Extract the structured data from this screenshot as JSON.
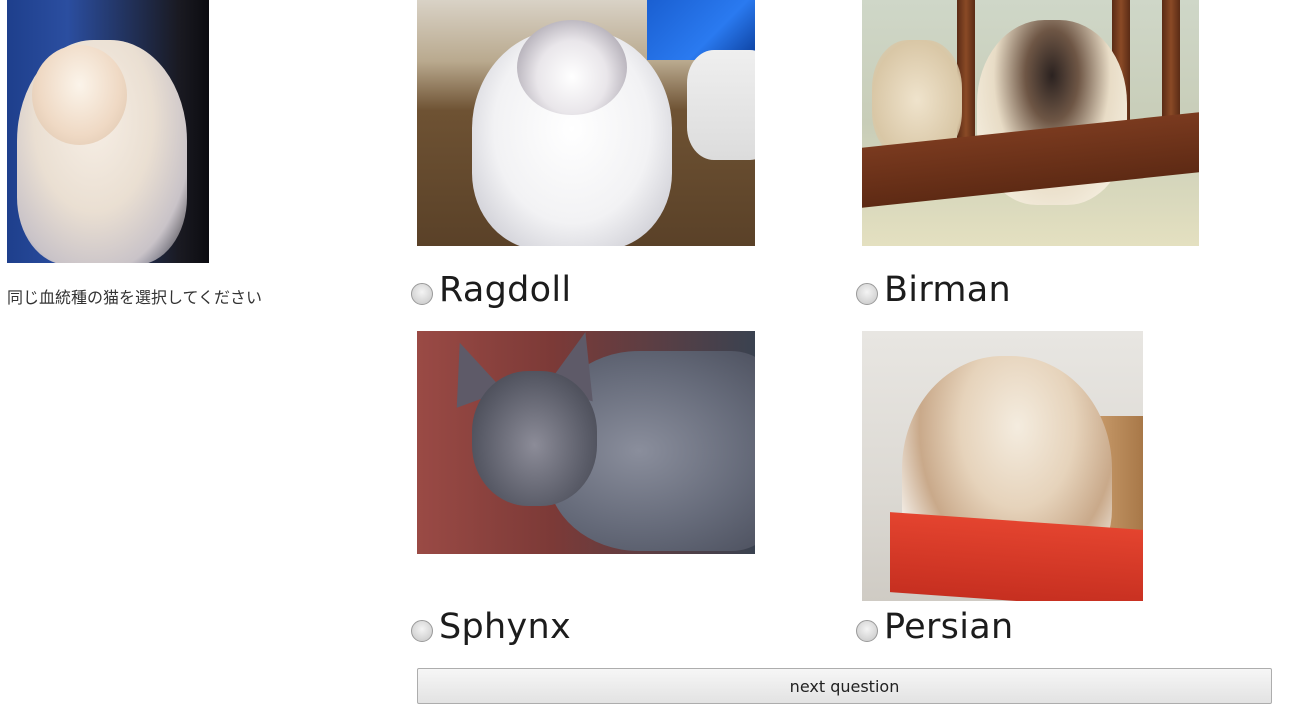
{
  "query": {
    "image_alt": "cream and white long-haired cat",
    "prompt": "同じ血統種の猫を選択してください"
  },
  "choices": [
    {
      "id": "ragdoll",
      "label": "Ragdoll"
    },
    {
      "id": "birman",
      "label": "Birman"
    },
    {
      "id": "sphynx",
      "label": "Sphynx"
    },
    {
      "id": "persian",
      "label": "Persian"
    }
  ],
  "next_button": {
    "label": "next question"
  },
  "colors": {
    "button_bg_top": "#f6f6f6",
    "button_bg_bottom": "#e3e3e3",
    "button_border": "#adadad",
    "text": "#1c1c1c"
  },
  "icons": {
    "radio": "radio-button-unchecked"
  }
}
